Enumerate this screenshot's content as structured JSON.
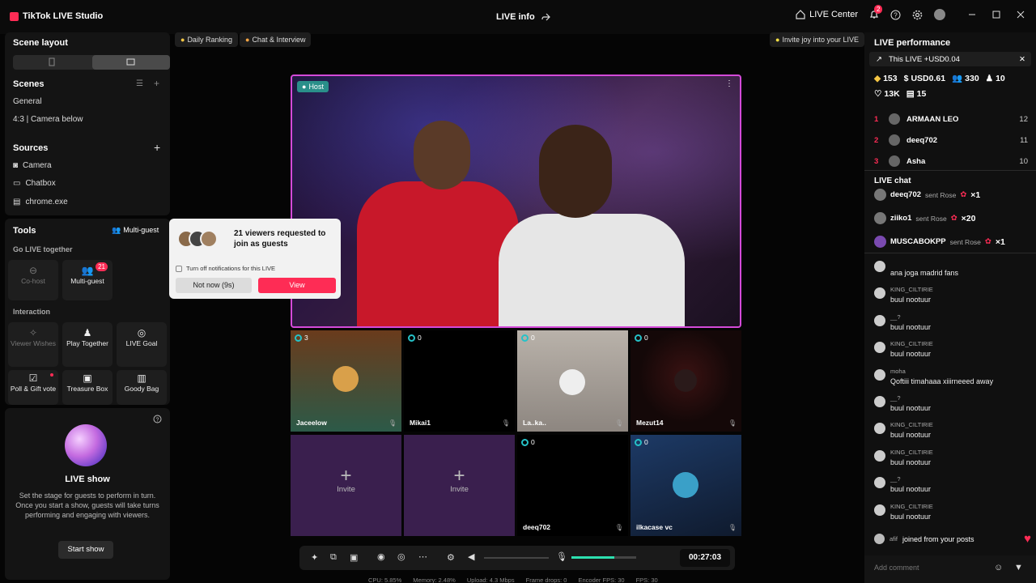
{
  "titlebar": {
    "app_name": "TikTok LIVE Studio",
    "center_title": "LIVE info",
    "live_center": "LIVE Center",
    "notif_count": "2"
  },
  "left": {
    "scene_layout": "Scene layout",
    "scenes_title": "Scenes",
    "scenes": [
      "General",
      "4:3 | Camera below"
    ],
    "sources_title": "Sources",
    "sources": [
      "Camera",
      "Chatbox",
      "chrome.exe"
    ],
    "tools_title": "Tools",
    "multi_guest_btn": "Multi-guest",
    "go_live_together": "Go LIVE together",
    "cohost": "Co-host",
    "multiguest": "Multi-guest",
    "multiguest_count": "21",
    "interaction": "Interaction",
    "viewer_wishes": "Viewer Wishes",
    "play_together": "Play Together",
    "live_goal": "LIVE Goal",
    "poll_gift": "Poll & Gift vote",
    "treasure_box": "Treasure Box",
    "goody_bag": "Goody Bag",
    "live_show_title": "LIVE show",
    "live_show_desc": "Set the stage for guests to perform in turn. Once you start a show, guests will take turns performing and engaging with viewers.",
    "start_show": "Start show"
  },
  "topbar": {
    "daily_ranking": "Daily Ranking",
    "chat_interview": "Chat & Interview",
    "invite_joy": "Invite joy into your LIVE"
  },
  "popup": {
    "text": "21 viewers requested to join as guests",
    "checkbox_label": "Turn off notifications for this LIVE",
    "not_now": "Not now (9s)",
    "view": "View"
  },
  "host": {
    "label": "Host"
  },
  "guests": [
    {
      "name": "Jaceelow",
      "count": "3"
    },
    {
      "name": "Mikai1",
      "count": "0"
    },
    {
      "name": "La..ka..",
      "count": "0"
    },
    {
      "name": "Mezut14",
      "count": "0"
    },
    {
      "name": "deeq702",
      "count": "0"
    },
    {
      "name": "ilkacase vc",
      "count": "0"
    }
  ],
  "invite_label": "Invite",
  "controls": {
    "timer": "00:27:03"
  },
  "status": {
    "cpu": "CPU: 5.85%",
    "memory": "Memory: 2.48%",
    "upload": "Upload: 4.3 Mbps",
    "frame_drops": "Frame drops: 0",
    "encoder_fps": "Encoder FPS: 30",
    "fps": "FPS: 30"
  },
  "right": {
    "live_performance": "LIVE performance",
    "this_live": "This LIVE +USD0.04",
    "stats": {
      "viewers": "153",
      "usd": "USD0.61",
      "followers": "330",
      "gifters": "10",
      "likes": "13K",
      "shares": "15"
    },
    "ranking": [
      {
        "rank": "1",
        "name": "ARMAAN LEO",
        "score": "12"
      },
      {
        "rank": "2",
        "name": "deeq702",
        "score": "11"
      },
      {
        "rank": "3",
        "name": "Asha",
        "score": "10"
      }
    ],
    "live_chat": "LIVE chat",
    "gifts": [
      {
        "user": "deeq702",
        "sent": "sent Rose",
        "qty": "×1"
      },
      {
        "user": "ziiko1",
        "sent": "sent Rose",
        "qty": "×20"
      },
      {
        "user": "MUSCABOKPP",
        "sent": "sent Rose",
        "qty": "×1"
      }
    ],
    "chat": [
      {
        "user": "",
        "msg": "ana joga madrid fans"
      },
      {
        "user": "KING_CILTIRIE",
        "msg": "buul nootuur"
      },
      {
        "user": "__?",
        "msg": "buul nootuur"
      },
      {
        "user": "KING_CILTIRIE",
        "msg": "buul nootuur"
      },
      {
        "user": "moha",
        "msg": "Qoftiii timahaaa xiiirneeed away"
      },
      {
        "user": "__?",
        "msg": "buul nootuur"
      },
      {
        "user": "KING_CILTIRIE",
        "msg": "buul nootuur"
      },
      {
        "user": "KING_CILTIRIE",
        "msg": "buul nootuur"
      },
      {
        "user": "__?",
        "msg": "buul nootuur"
      },
      {
        "user": "KING_CILTIRIE",
        "msg": "buul nootuur"
      }
    ],
    "joined_user": "afif",
    "joined_text": "joined from your posts",
    "add_comment": "Add comment"
  }
}
